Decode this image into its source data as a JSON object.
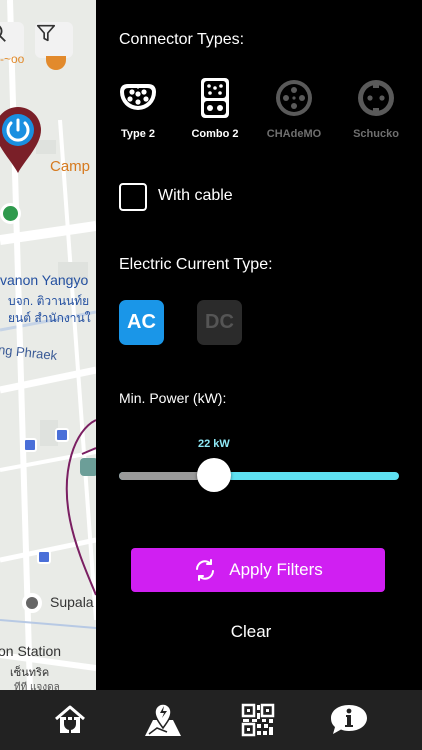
{
  "map": {
    "labels": {
      "camp": "Camp",
      "vanon": "vanon Yangyo",
      "thai1": "บจก. ติวานนท์ย",
      "thai2": "ยนต์ สำนักงานใ",
      "phraek": "ng Phraek",
      "supala": "Supala",
      "station": "on Station",
      "thai3": "เซ็นทริค",
      "thai4": "ทีที แจงดล"
    },
    "icons": [
      "search-icon",
      "filter-icon",
      "power-marker-icon"
    ]
  },
  "filters": {
    "connector_title": "Connector Types:",
    "connectors": [
      {
        "label": "Type 2",
        "active": true
      },
      {
        "label": "Combo 2",
        "active": true
      },
      {
        "label": "CHAdeMO",
        "active": false
      },
      {
        "label": "Schucko",
        "active": false
      }
    ],
    "with_cable_label": "With cable",
    "with_cable_checked": false,
    "current_title": "Electric Current Type:",
    "current_types": [
      {
        "label": "AC",
        "active": true
      },
      {
        "label": "DC",
        "active": false
      }
    ],
    "power_title": "Min. Power (kW):",
    "power_value_label": "22 kW",
    "power_fraction": 0.34,
    "apply_label": "Apply Filters",
    "clear_label": "Clear"
  },
  "colors": {
    "accent_purple": "#d01ff2",
    "ac_blue": "#1a96e8",
    "slider_cyan": "#5ee1f2",
    "nav_bg": "#222222"
  },
  "bottom_nav": {
    "icons": [
      "home-charger-icon",
      "map-route-icon",
      "qr-code-icon",
      "info-icon"
    ]
  }
}
